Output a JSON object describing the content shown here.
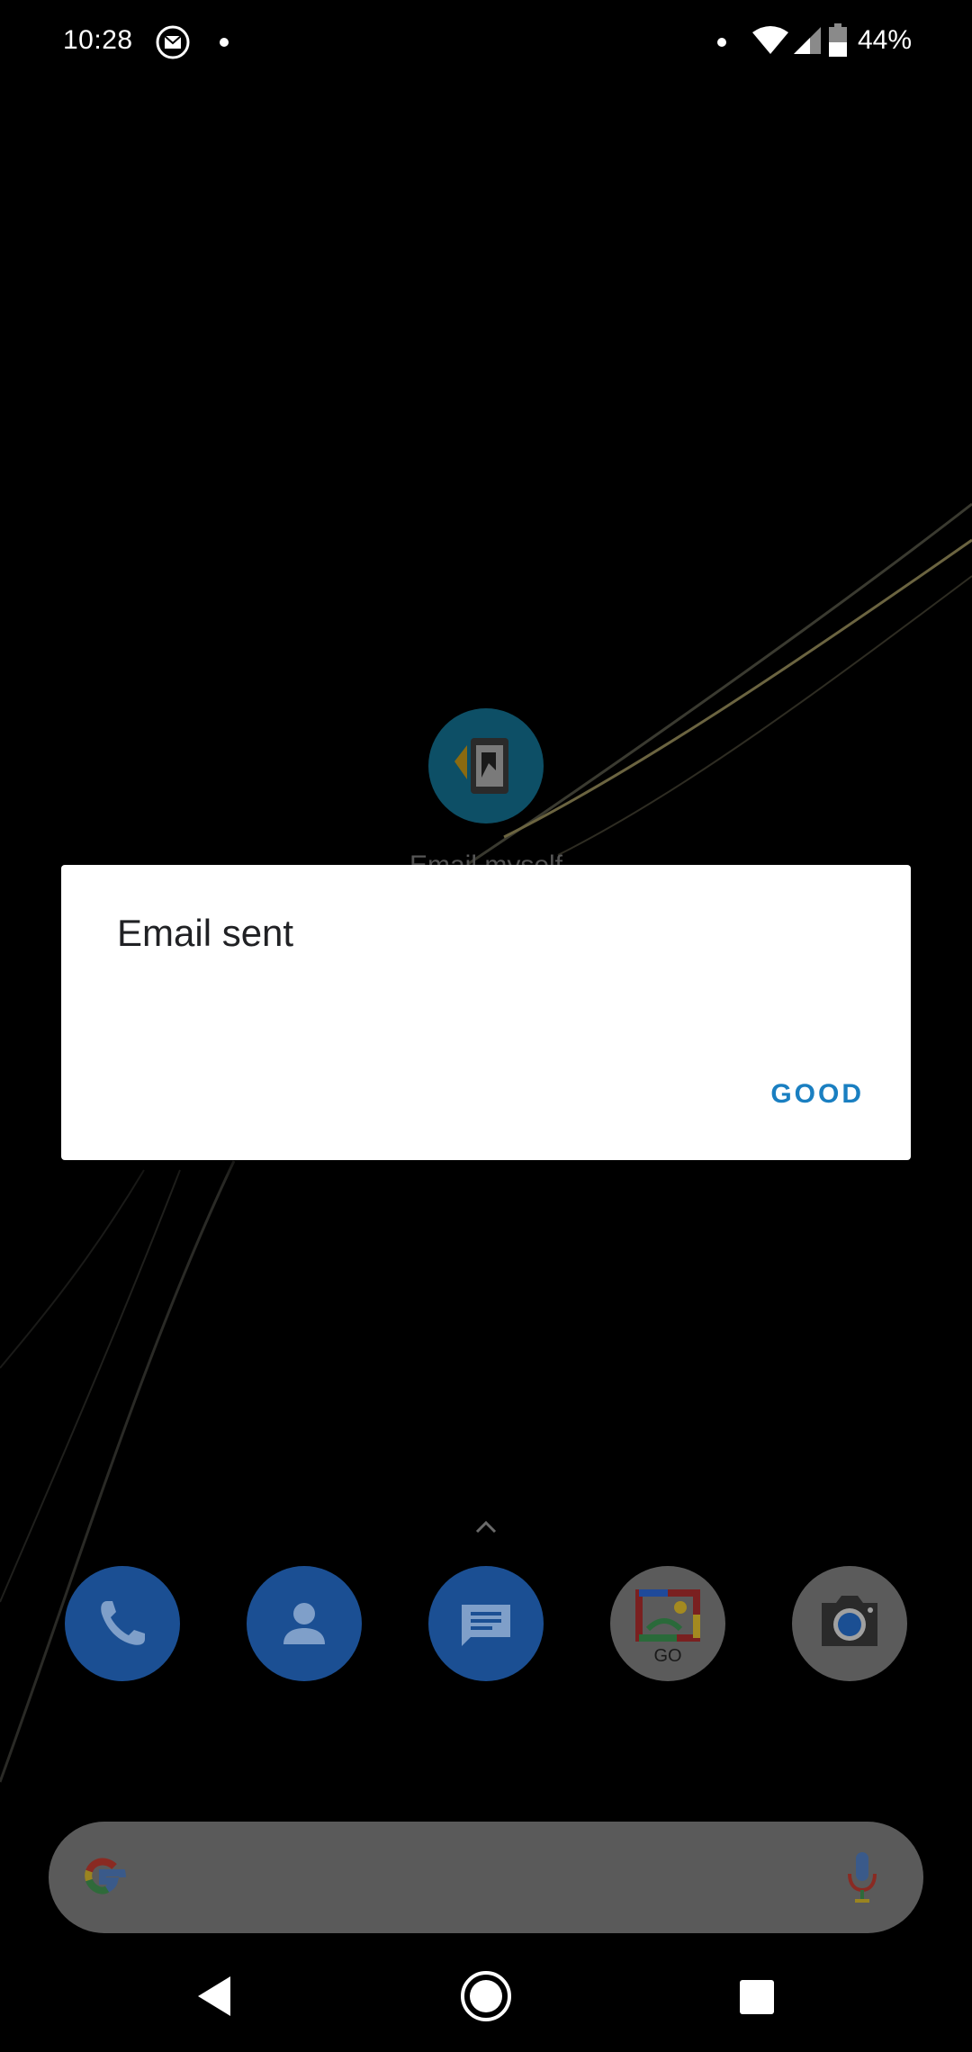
{
  "status_bar": {
    "time": "10:28",
    "battery_percent": "44%",
    "icons": [
      "gmail-icon",
      "notification-dot",
      "wifi-icon",
      "signal-icon",
      "battery-icon"
    ]
  },
  "home": {
    "shortcut_label": "Email myself",
    "shortcut_icon": "shortcut-icon"
  },
  "dialog": {
    "title": "Email sent",
    "button_label": "GOOD",
    "button_color": "#1a7fc1"
  },
  "dock": {
    "apps": [
      "phone-icon",
      "contacts-icon",
      "messages-icon",
      "gallery-go-icon",
      "camera-icon"
    ],
    "gallery_badge": "GO"
  },
  "search": {
    "icons": [
      "google-icon",
      "mic-icon"
    ]
  },
  "navigation": {
    "buttons": [
      "back",
      "home",
      "recents"
    ]
  }
}
